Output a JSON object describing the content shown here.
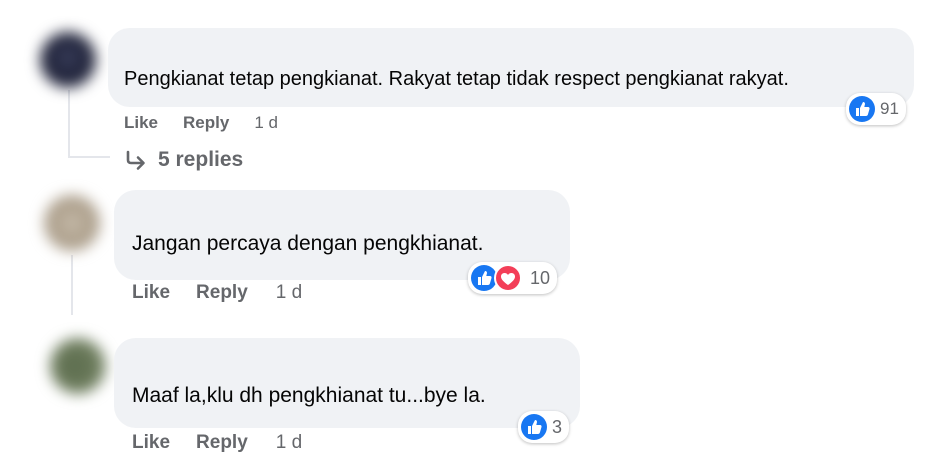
{
  "colors": {
    "bubble": "#f0f2f5",
    "meta_text": "#65676b",
    "like_blue": "#1877f2",
    "love_red": "#f33e58"
  },
  "comments": [
    {
      "text": "Pengkianat tetap pengkianat. Rakyat tetap tidak respect pengkianat rakyat.",
      "like_label": "Like",
      "reply_label": "Reply",
      "time": "1 d",
      "reactions": [
        "like-icon"
      ],
      "reaction_count": "91"
    },
    {
      "text": "Jangan percaya dengan pengkhianat.",
      "like_label": "Like",
      "reply_label": "Reply",
      "time": "1 d",
      "reactions": [
        "like-icon",
        "love-icon"
      ],
      "reaction_count": "10"
    },
    {
      "text": "Maaf la,klu dh pengkhianat tu...bye la.",
      "like_label": "Like",
      "reply_label": "Reply",
      "time": "1 d",
      "reactions": [
        "like-icon"
      ],
      "reaction_count": "3"
    }
  ],
  "replies_link": {
    "label": "5 replies",
    "icon": "reply-arrow-icon"
  }
}
